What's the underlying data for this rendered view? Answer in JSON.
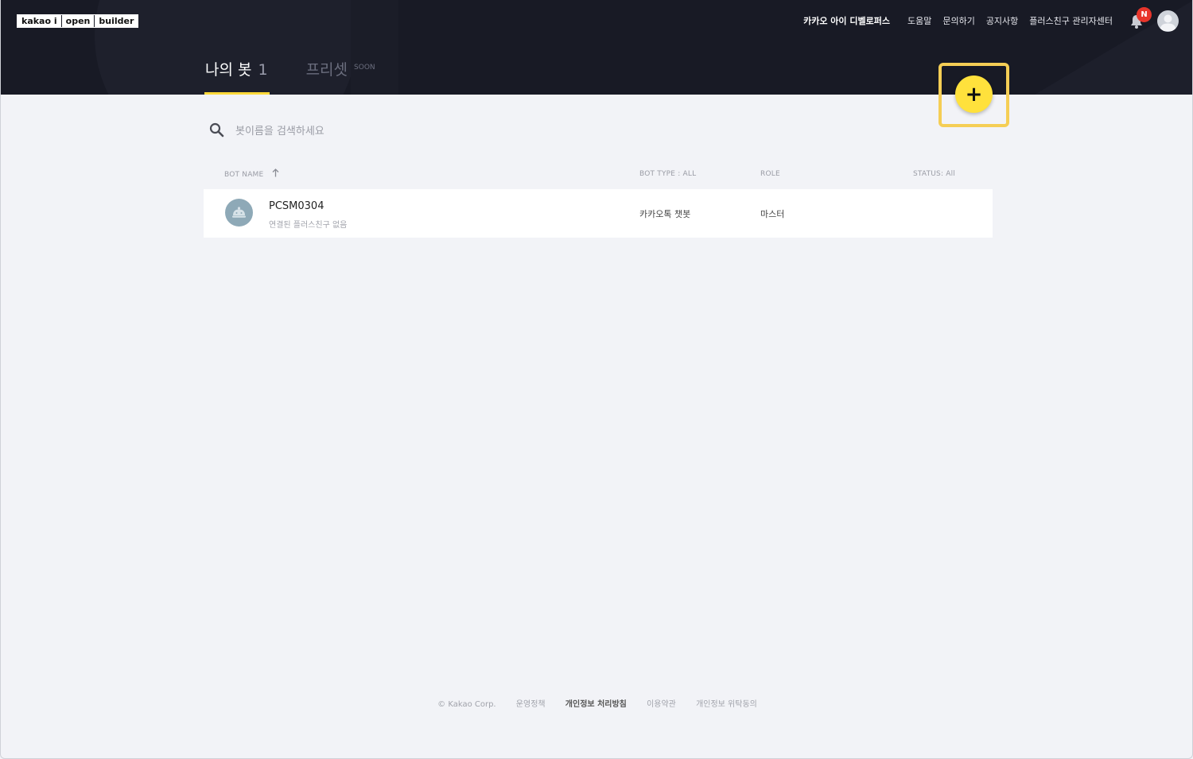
{
  "logo": {
    "part1": "kakao i",
    "part2": "open",
    "part3": "builder"
  },
  "topnav": {
    "items": [
      "카카오 아이 디벨로퍼스",
      "도움말",
      "문의하기",
      "공지사항",
      "플러스친구 관리자센터"
    ]
  },
  "notifications": {
    "badge": "N"
  },
  "tabs": {
    "my_bots": {
      "label": "나의 봇",
      "count": "1"
    },
    "preset": {
      "label": "프리셋",
      "tag": "SOON"
    }
  },
  "add_button": {
    "label": "+"
  },
  "search": {
    "placeholder": "봇이름을 검색하세요"
  },
  "table": {
    "headers": {
      "bot_name": "BOT NAME",
      "bot_type": "BOT TYPE : ALL",
      "role": "ROLE",
      "status": "STATUS: All"
    },
    "rows": [
      {
        "name": "PCSM0304",
        "sub": "연결된 플러스친구 없음",
        "type": "카카오톡 챗봇",
        "role": "마스터",
        "status": ""
      }
    ]
  },
  "footer": {
    "items": [
      "© Kakao Corp.",
      "운영정책",
      "개인정보 처리방침",
      "이용약관",
      "개인정보 위탁동의"
    ]
  },
  "colors": {
    "header_bg": "#181a25",
    "accent": "#ffe13c",
    "highlight": "#f5ce55",
    "page_bg": "#f2f3f7"
  }
}
